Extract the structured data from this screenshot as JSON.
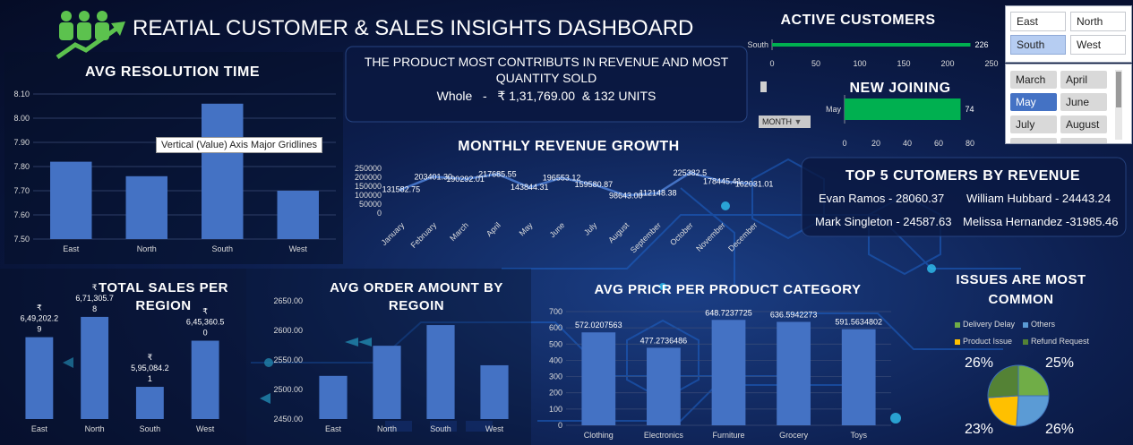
{
  "header": {
    "title": "REATIAL CUSTOMER & SALES INSIGHTS DASHBOARD"
  },
  "highlight": {
    "headline": "THE PRODUCT MOST CONTRIBUTS IN REVENUE AND MOST QUANTITY SOLD",
    "detail": "Whole   -   ₹ 1,31,769.00  & 132 UNITS"
  },
  "filter_button": {
    "label": "MONTH"
  },
  "tooltip": {
    "text": "Vertical (Value) Axis Major Gridlines"
  },
  "region_slicer": {
    "items": [
      {
        "label": "East",
        "selected": false
      },
      {
        "label": "North",
        "selected": false
      },
      {
        "label": "South",
        "selected": true
      },
      {
        "label": "West",
        "selected": false
      }
    ]
  },
  "month_slicer": {
    "items": [
      {
        "label": "March",
        "selected": false
      },
      {
        "label": "April",
        "selected": false
      },
      {
        "label": "May",
        "selected": true
      },
      {
        "label": "June",
        "selected": false
      },
      {
        "label": "July",
        "selected": false
      },
      {
        "label": "August",
        "selected": false
      }
    ]
  },
  "top_customers": {
    "title": "TOP 5 CUTOMERS BY REVENUE",
    "entries": [
      "Evan Ramos - 28060.37",
      "William Hubbard - 24443.24",
      "Mark Singleton - 24587.63",
      "Melissa Hernandez -31985.46"
    ]
  },
  "colors": {
    "bar": "#4472c4",
    "bar_dark": "#2f5597",
    "green": "#00b050",
    "line": "#4472c4"
  },
  "chart_data": [
    {
      "id": "avg_resolution",
      "type": "bar",
      "title": "AVG RESOLUTION TIME",
      "categories": [
        "East",
        "North",
        "South",
        "West"
      ],
      "values": [
        7.82,
        7.76,
        8.06,
        7.7
      ],
      "ylim": [
        7.5,
        8.1
      ],
      "yticks": [
        "8.10",
        "8.00",
        "7.90",
        "7.80",
        "7.70",
        "7.60",
        "7.50"
      ],
      "grid": true
    },
    {
      "id": "active_customers",
      "type": "bar",
      "orientation": "horizontal",
      "title": "ACTIVE CUSTOMERS",
      "categories": [
        "South"
      ],
      "values": [
        226
      ],
      "xlim": [
        0,
        250
      ],
      "xticks": [
        "0",
        "50",
        "100",
        "150",
        "200",
        "250"
      ],
      "labels": [
        "226"
      ]
    },
    {
      "id": "new_joining",
      "type": "bar",
      "orientation": "horizontal",
      "title": "NEW JOINING",
      "categories": [
        "May"
      ],
      "values": [
        74
      ],
      "xlim": [
        0,
        80
      ],
      "xticks": [
        "0",
        "20",
        "40",
        "60",
        "80"
      ],
      "labels": [
        "74"
      ]
    },
    {
      "id": "monthly_revenue",
      "type": "line",
      "title": "MONTHLY REVENUE GROWTH",
      "categories": [
        "January",
        "February",
        "March",
        "April",
        "May",
        "June",
        "July",
        "August",
        "September",
        "October",
        "November",
        "December"
      ],
      "values": [
        131582.75,
        203401.3,
        190292.01,
        217685.55,
        143844.31,
        196553.12,
        159580.87,
        98643.0,
        112148.38,
        225382.5,
        178445.41,
        162031.01
      ],
      "labels": [
        "131582.75",
        "203401.30",
        "190292.01",
        "217685.55",
        "143844.31",
        "196553.12",
        "159580.87",
        "98643.00",
        "112148.38",
        "225382.5",
        "178445.41",
        "162031.01"
      ],
      "ylim": [
        0,
        250000
      ],
      "yticks": [
        "250000",
        "200000",
        "150000",
        "100000",
        "50000",
        "0"
      ]
    },
    {
      "id": "total_sales_region",
      "type": "bar",
      "title": "TOTAL SALES PER REGION",
      "categories": [
        "East",
        "North",
        "South",
        "West"
      ],
      "values": [
        649202.29,
        671305.78,
        595084.21,
        645360.5
      ],
      "labels": [
        [
          "₹",
          "6,49,202.2",
          "9"
        ],
        [
          "₹",
          "6,71,305.7",
          "8"
        ],
        [
          "₹",
          "5,95,084.2",
          "1"
        ],
        [
          "₹",
          "6,45,360.5",
          "0"
        ]
      ],
      "ylim": [
        560000,
        680000
      ]
    },
    {
      "id": "avg_order_region",
      "type": "bar",
      "title": "AVG ORDER AMOUNT BY REGOIN",
      "categories": [
        "East",
        "North",
        "South",
        "West"
      ],
      "values": [
        2523,
        2574,
        2609,
        2541
      ],
      "ylim": [
        2450,
        2650
      ],
      "yticks": [
        "2650.00",
        "2600.00",
        "2550.00",
        "2500.00",
        "2450.00"
      ]
    },
    {
      "id": "avg_price_category",
      "type": "bar",
      "title": "AVG PRICR PER PRODUCT CATEGORY",
      "categories": [
        "Clothing",
        "Electronics",
        "Furniture",
        "Grocery",
        "Toys"
      ],
      "values": [
        572.0207563,
        477.2736486,
        648.7237725,
        636.5942273,
        591.5634802
      ],
      "labels": [
        "572.0207563",
        "477.2736486",
        "648.7237725",
        "636.5942273",
        "591.5634802"
      ],
      "ylim": [
        0,
        700
      ],
      "yticks": [
        "700",
        "600",
        "500",
        "400",
        "300",
        "200",
        "100",
        "0"
      ]
    },
    {
      "id": "common_issues",
      "type": "pie",
      "title": "ISSUES ARE MOST COMMON",
      "categories": [
        "Delivery Delay",
        "Others",
        "Product Issue",
        "Refund Request"
      ],
      "values": [
        25,
        26,
        23,
        26
      ],
      "labels": [
        "25%",
        "26%",
        "23%",
        "26%"
      ],
      "colors": [
        "#70ad47",
        "#5b9bd5",
        "#ffc000",
        "#548235"
      ]
    }
  ]
}
